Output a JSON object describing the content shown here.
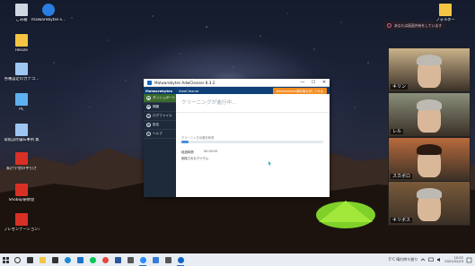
{
  "desktop_icons": [
    {
      "name": "trash-icon",
      "label": "ごみ箱"
    },
    {
      "name": "malwarebytes-desktop-icon",
      "label": "malwarebytes-s..."
    },
    {
      "name": "folder-resize-icon",
      "label": "Resize"
    },
    {
      "name": "shortcut-icon",
      "label": "各種設定のカテゴ..."
    },
    {
      "name": "pc-icon",
      "label": "PC"
    },
    {
      "name": "shortcut-icon",
      "label": "取扱説明書&事例 集"
    },
    {
      "name": "pdf-icon",
      "label": "家計学習の手引き"
    },
    {
      "name": "pdf-icon",
      "label": "Shoboji研修会"
    },
    {
      "name": "pdf-icon",
      "label": "プレゼンテーション1.pdf"
    },
    {
      "name": "folder-icon",
      "label": "フォルダー"
    },
    {
      "name": "folder-icon",
      "label": "資料の保存フォ"
    }
  ],
  "window": {
    "title": "Malwarebytes AdwCleaner 8.3.2",
    "controls": {
      "minimize": "—",
      "maximize": "☐",
      "close": "✕"
    }
  },
  "app": {
    "logo": "Malwarebytes",
    "header_title": "AdwCleaner",
    "upgrade_button": "Malwarebytes無料版を試してみる",
    "status": "クリーニングが進行中...",
    "progress_label": "クリーニングの進行状況",
    "progress": 0.05,
    "info": [
      {
        "key": "経過時間",
        "value": "00:00:05"
      },
      {
        "key": "削除されたアイテム",
        "value": ""
      }
    ],
    "sidebar": [
      {
        "label": "ダッシュボード",
        "icon": "dashboard-icon",
        "active": true
      },
      {
        "label": "隔離",
        "icon": "quarantine-icon",
        "active": false
      },
      {
        "label": "ログファイル",
        "icon": "log-icon",
        "active": false
      },
      {
        "label": "設定",
        "icon": "gear-icon",
        "active": false
      },
      {
        "label": "ヘルプ",
        "icon": "help-icon",
        "active": false
      }
    ]
  },
  "notification": {
    "text": "あなたは画面共有をしています"
  },
  "participants": [
    {
      "name": "キリン",
      "bg": "#c9b28a"
    },
    {
      "name": "レル",
      "bg": "#8a8f7a"
    },
    {
      "name": "スカボロ",
      "bg": "#b86a3c"
    },
    {
      "name": "キリボス",
      "bg": "#7a5a3a"
    }
  ],
  "taskbar": {
    "apps": [
      "search-icon",
      "task-view-icon",
      "file-explorer-icon",
      "store-icon",
      "edge-icon",
      "mail-icon",
      "line-icon",
      "chrome-icon",
      "word-icon",
      "camera-icon",
      "zoom-icon",
      "photos-icon",
      "settings-icon",
      "malwarebytes-icon"
    ],
    "weather": "5°C 晴れ時々曇り",
    "time": "10:52",
    "date": "2021/01/23"
  }
}
